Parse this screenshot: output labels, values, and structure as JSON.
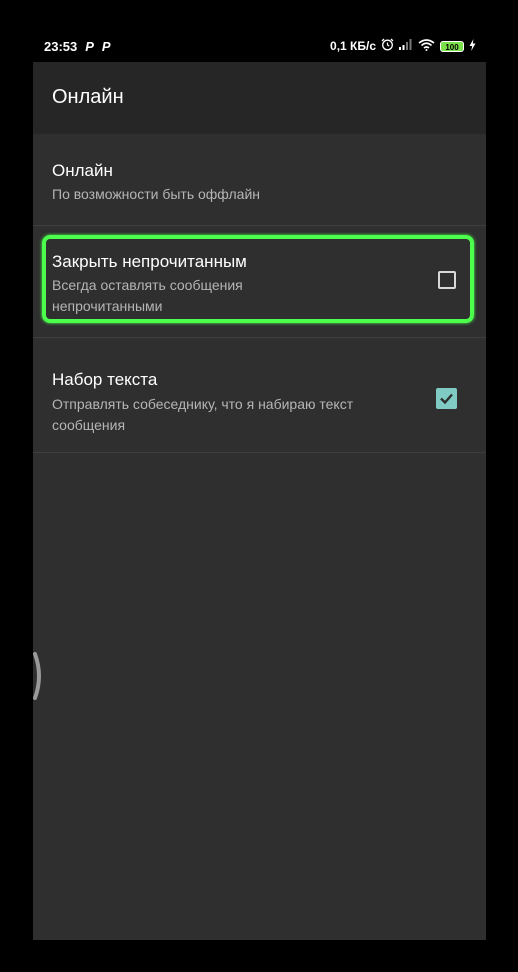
{
  "status_bar": {
    "time": "23:53",
    "left_icons": [
      "P",
      "P"
    ],
    "network_speed": "0,1 КБ/с",
    "battery": "100",
    "icons": [
      "alarm-icon",
      "signal-icon",
      "wifi-icon",
      "battery-icon",
      "charging-icon"
    ]
  },
  "toolbar": {
    "title": "Онлайн"
  },
  "settings": [
    {
      "title": "Онлайн",
      "subtitle": "По возможности быть оффлайн"
    },
    {
      "title": "Закрыть непрочитанным",
      "subtitle": "Всегда оставлять сообщения непрочитанными",
      "checked": false
    },
    {
      "title": "Набор текста",
      "subtitle": "Отправлять собеседнику, что я набираю текст сообщения",
      "checked": true
    }
  ],
  "colors": {
    "background": "#2f2f2f",
    "toolbar": "#262626",
    "highlight": "#4cff4c",
    "checkbox_accent": "#80cbc4"
  }
}
